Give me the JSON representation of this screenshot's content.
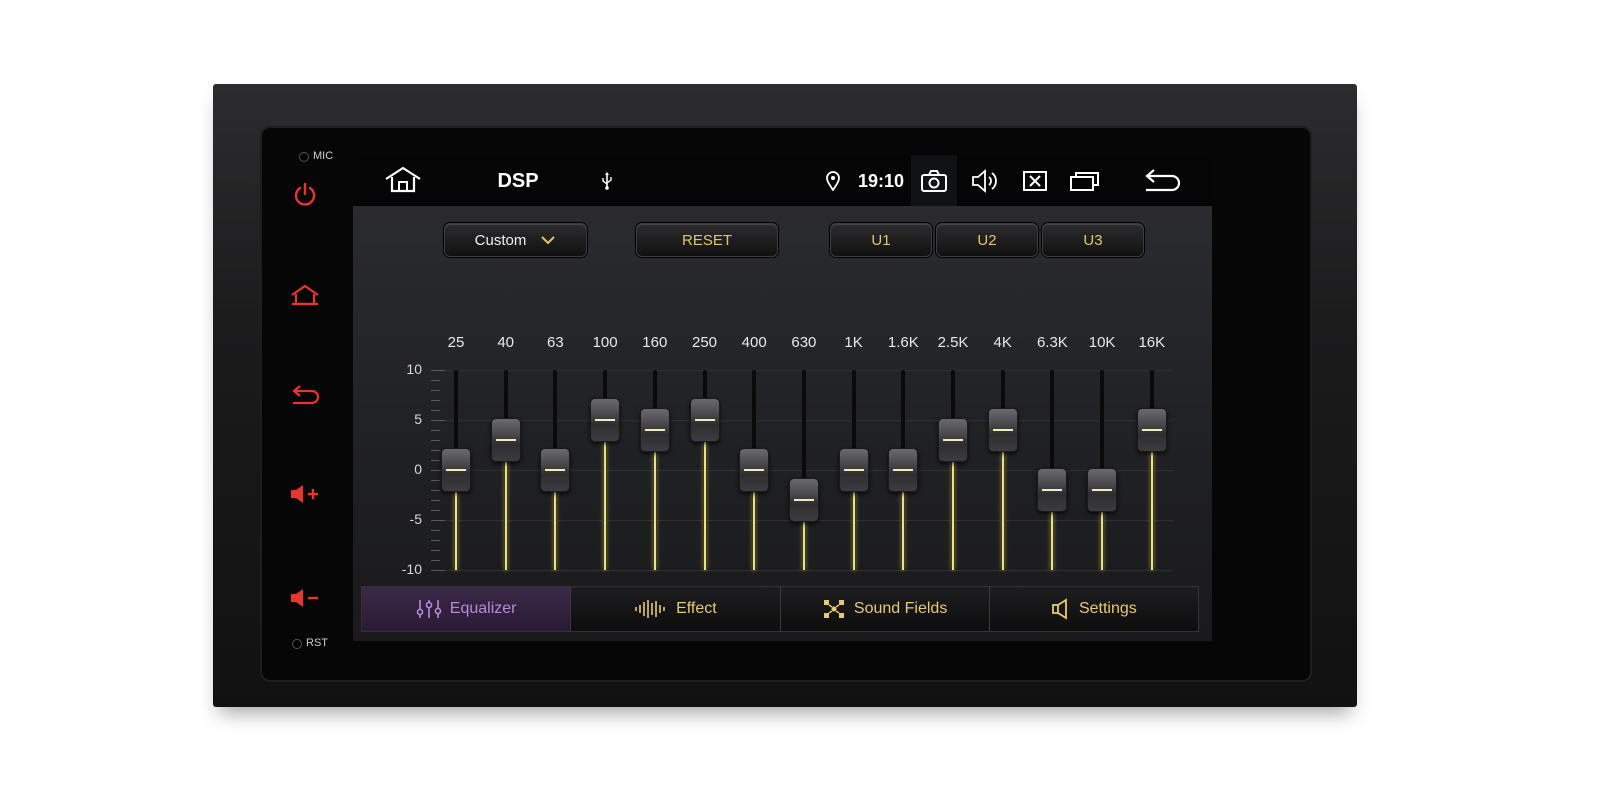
{
  "device": {
    "mic_label": "MIC",
    "rst_label": "RST",
    "side_buttons": [
      {
        "name": "power-icon"
      },
      {
        "name": "home-icon"
      },
      {
        "name": "back-icon"
      },
      {
        "name": "volume-up-icon"
      },
      {
        "name": "volume-down-icon"
      }
    ],
    "accent_color": "#e8352f"
  },
  "statusbar": {
    "title": "DSP",
    "time": "19:10",
    "icons": [
      "home-icon",
      "usb-icon",
      "location-icon",
      "camera-icon",
      "volume-icon",
      "close-box-icon",
      "recent-apps-icon",
      "back-icon"
    ]
  },
  "eq": {
    "preset": "Custom",
    "reset_label": "RESET",
    "user_presets": [
      "U1",
      "U2",
      "U3"
    ],
    "y_ticks": [
      "10",
      "5",
      "0",
      "-5",
      "-10"
    ],
    "y_range": [
      -10,
      10
    ],
    "bands": [
      {
        "freq": "25",
        "value": 0
      },
      {
        "freq": "40",
        "value": 3
      },
      {
        "freq": "63",
        "value": 0
      },
      {
        "freq": "100",
        "value": 5
      },
      {
        "freq": "160",
        "value": 4
      },
      {
        "freq": "250",
        "value": 5
      },
      {
        "freq": "400",
        "value": 0
      },
      {
        "freq": "630",
        "value": -3
      },
      {
        "freq": "1K",
        "value": 0
      },
      {
        "freq": "1.6K",
        "value": 0
      },
      {
        "freq": "2.5K",
        "value": 3
      },
      {
        "freq": "4K",
        "value": 4
      },
      {
        "freq": "6.3K",
        "value": -2
      },
      {
        "freq": "10K",
        "value": -2
      },
      {
        "freq": "16K",
        "value": 4
      }
    ]
  },
  "tabs": [
    {
      "label": "Equalizer",
      "icon": "equalizer-icon",
      "active": true
    },
    {
      "label": "Effect",
      "icon": "waveform-icon",
      "active": false
    },
    {
      "label": "Sound Fields",
      "icon": "sound-fields-icon",
      "active": false
    },
    {
      "label": "Settings",
      "icon": "speaker-icon",
      "active": false
    }
  ]
}
